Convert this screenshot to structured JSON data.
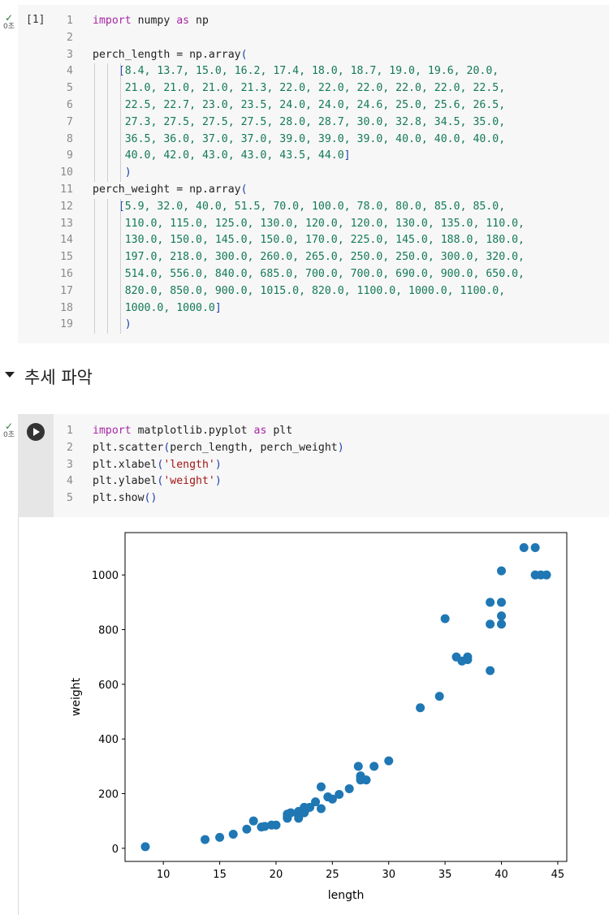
{
  "cell1": {
    "status": "0초",
    "exec_count": "[1]",
    "lines": [
      {
        "n": "1",
        "parts": [
          [
            "kw",
            "import"
          ],
          [
            "pl",
            " numpy "
          ],
          [
            "kw",
            "as"
          ],
          [
            "pl",
            " np"
          ]
        ]
      },
      {
        "n": "2",
        "parts": []
      },
      {
        "n": "3",
        "parts": [
          [
            "pl",
            "perch_length = np.array"
          ],
          [
            "par",
            "("
          ]
        ]
      },
      {
        "n": "4",
        "parts": [
          [
            "pl",
            "    "
          ],
          [
            "par",
            "["
          ],
          [
            "num",
            "8.4, 13.7, 15.0, 16.2, 17.4, 18.0, 18.7, 19.0, 19.6, 20.0,"
          ]
        ]
      },
      {
        "n": "5",
        "parts": [
          [
            "pl",
            "     "
          ],
          [
            "num",
            "21.0, 21.0, 21.0, 21.3, 22.0, 22.0, 22.0, 22.0, 22.0, 22.5,"
          ]
        ]
      },
      {
        "n": "6",
        "parts": [
          [
            "pl",
            "     "
          ],
          [
            "num",
            "22.5, 22.7, 23.0, 23.5, 24.0, 24.0, 24.6, 25.0, 25.6, 26.5,"
          ]
        ]
      },
      {
        "n": "7",
        "parts": [
          [
            "pl",
            "     "
          ],
          [
            "num",
            "27.3, 27.5, 27.5, 27.5, 28.0, 28.7, 30.0, 32.8, 34.5, 35.0,"
          ]
        ]
      },
      {
        "n": "8",
        "parts": [
          [
            "pl",
            "     "
          ],
          [
            "num",
            "36.5, 36.0, 37.0, 37.0, 39.0, 39.0, 39.0, 40.0, 40.0, 40.0,"
          ]
        ]
      },
      {
        "n": "9",
        "parts": [
          [
            "pl",
            "     "
          ],
          [
            "num",
            "40.0, 42.0, 43.0, 43.0, 43.5, 44.0"
          ],
          [
            "par",
            "]"
          ]
        ]
      },
      {
        "n": "10",
        "parts": [
          [
            "pl",
            "     "
          ],
          [
            "par",
            ")"
          ]
        ]
      },
      {
        "n": "11",
        "parts": [
          [
            "pl",
            "perch_weight = np.array"
          ],
          [
            "par",
            "("
          ]
        ]
      },
      {
        "n": "12",
        "parts": [
          [
            "pl",
            "    "
          ],
          [
            "par",
            "["
          ],
          [
            "num",
            "5.9, 32.0, 40.0, 51.5, 70.0, 100.0, 78.0, 80.0, 85.0, 85.0,"
          ]
        ]
      },
      {
        "n": "13",
        "parts": [
          [
            "pl",
            "     "
          ],
          [
            "num",
            "110.0, 115.0, 125.0, 130.0, 120.0, 120.0, 130.0, 135.0, 110.0,"
          ]
        ]
      },
      {
        "n": "14",
        "parts": [
          [
            "pl",
            "     "
          ],
          [
            "num",
            "130.0, 150.0, 145.0, 150.0, 170.0, 225.0, 145.0, 188.0, 180.0,"
          ]
        ]
      },
      {
        "n": "15",
        "parts": [
          [
            "pl",
            "     "
          ],
          [
            "num",
            "197.0, 218.0, 300.0, 260.0, 265.0, 250.0, 250.0, 300.0, 320.0,"
          ]
        ]
      },
      {
        "n": "16",
        "parts": [
          [
            "pl",
            "     "
          ],
          [
            "num",
            "514.0, 556.0, 840.0, 685.0, 700.0, 700.0, 690.0, 900.0, 650.0,"
          ]
        ]
      },
      {
        "n": "17",
        "parts": [
          [
            "pl",
            "     "
          ],
          [
            "num",
            "820.0, 850.0, 900.0, 1015.0, 820.0, 1100.0, 1000.0, 1100.0,"
          ]
        ]
      },
      {
        "n": "18",
        "parts": [
          [
            "pl",
            "     "
          ],
          [
            "num",
            "1000.0, 1000.0"
          ],
          [
            "par",
            "]"
          ]
        ]
      },
      {
        "n": "19",
        "parts": [
          [
            "pl",
            "     "
          ],
          [
            "par",
            ")"
          ]
        ]
      }
    ]
  },
  "section": {
    "title": "추세 파악"
  },
  "cell2": {
    "status": "0초",
    "lines": [
      {
        "n": "1",
        "parts": [
          [
            "kw",
            "import"
          ],
          [
            "pl",
            " matplotlib.pyplot "
          ],
          [
            "kw",
            "as"
          ],
          [
            "pl",
            " plt"
          ]
        ]
      },
      {
        "n": "2",
        "parts": [
          [
            "pl",
            "plt.scatter"
          ],
          [
            "par",
            "("
          ],
          [
            "pl",
            "perch_length, perch_weight"
          ],
          [
            "par",
            ")"
          ]
        ]
      },
      {
        "n": "3",
        "parts": [
          [
            "pl",
            "plt.xlabel"
          ],
          [
            "par",
            "("
          ],
          [
            "str",
            "'length'"
          ],
          [
            "par",
            ")"
          ]
        ]
      },
      {
        "n": "4",
        "parts": [
          [
            "pl",
            "plt.ylabel"
          ],
          [
            "par",
            "("
          ],
          [
            "str",
            "'weight'"
          ],
          [
            "par",
            ")"
          ]
        ]
      },
      {
        "n": "5",
        "parts": [
          [
            "pl",
            "plt.show"
          ],
          [
            "par",
            "()"
          ]
        ]
      }
    ]
  },
  "colors": {
    "marker": "#1f77b4",
    "keyword": "#a626a4",
    "number": "#137a57",
    "string": "#a31515",
    "paren": "#1e40af"
  },
  "chart_data": {
    "type": "scatter",
    "title": "",
    "xlabel": "length",
    "ylabel": "weight",
    "xlim": [
      6.6,
      45.8
    ],
    "ylim": [
      -48,
      1155
    ],
    "xticks": [
      10,
      15,
      20,
      25,
      30,
      35,
      40,
      45
    ],
    "yticks": [
      0,
      200,
      400,
      600,
      800,
      1000
    ],
    "grid": false,
    "x": [
      8.4,
      13.7,
      15.0,
      16.2,
      17.4,
      18.0,
      18.7,
      19.0,
      19.6,
      20.0,
      21.0,
      21.0,
      21.0,
      21.3,
      22.0,
      22.0,
      22.0,
      22.0,
      22.0,
      22.5,
      22.5,
      22.7,
      23.0,
      23.5,
      24.0,
      24.0,
      24.6,
      25.0,
      25.6,
      26.5,
      27.3,
      27.5,
      27.5,
      27.5,
      28.0,
      28.7,
      30.0,
      32.8,
      34.5,
      35.0,
      36.5,
      36.0,
      37.0,
      37.0,
      39.0,
      39.0,
      39.0,
      40.0,
      40.0,
      40.0,
      40.0,
      42.0,
      43.0,
      43.0,
      43.5,
      44.0
    ],
    "y": [
      5.9,
      32.0,
      40.0,
      51.5,
      70.0,
      100.0,
      78.0,
      80.0,
      85.0,
      85.0,
      110.0,
      115.0,
      125.0,
      130.0,
      120.0,
      120.0,
      130.0,
      135.0,
      110.0,
      130.0,
      150.0,
      145.0,
      150.0,
      170.0,
      225.0,
      145.0,
      188.0,
      180.0,
      197.0,
      218.0,
      300.0,
      260.0,
      265.0,
      250.0,
      250.0,
      300.0,
      320.0,
      514.0,
      556.0,
      840.0,
      685.0,
      700.0,
      700.0,
      690.0,
      900.0,
      650.0,
      820.0,
      850.0,
      900.0,
      1015.0,
      820.0,
      1100.0,
      1000.0,
      1100.0,
      1000.0,
      1000.0
    ]
  }
}
